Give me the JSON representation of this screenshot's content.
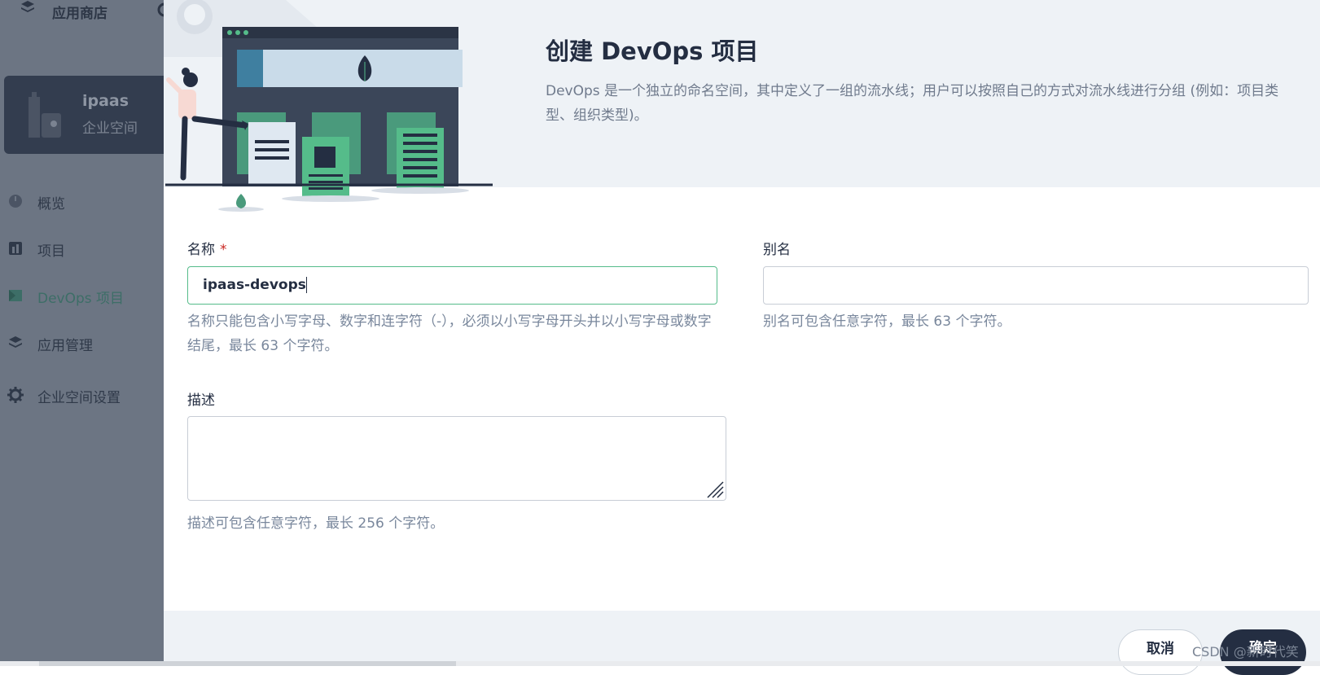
{
  "sidebar": {
    "app_store_label": "应用商店",
    "workspace": {
      "name": "ipaas",
      "type": "企业空间"
    },
    "items": [
      {
        "label": "概览",
        "icon": "dashboard-icon",
        "active": false
      },
      {
        "label": "项目",
        "icon": "project-icon",
        "active": false
      },
      {
        "label": "DevOps 项目",
        "icon": "devops-icon",
        "active": true
      },
      {
        "label": "应用管理",
        "icon": "app-layers-icon",
        "active": false
      },
      {
        "label": "企业空间设置",
        "icon": "gear-icon",
        "active": false
      }
    ]
  },
  "modal": {
    "title": "创建 DevOps 项目",
    "description": "DevOps 是一个独立的命名空间，其中定义了一组的流水线；用户可以按照自己的方式对流水线进行分组 (例如：项目类型、组织类型)。",
    "name_field": {
      "label": "名称",
      "required_mark": "*",
      "value": "ipaas-devops",
      "hint": "名称只能包含小写字母、数字和连字符（-），必须以小写字母开头并以小写字母或数字结尾，最长 63 个字符。"
    },
    "alias_field": {
      "label": "别名",
      "value": "",
      "hint": "别名可包含任意字符，最长 63 个字符。"
    },
    "description_field": {
      "label": "描述",
      "value": "",
      "hint": "描述可包含任意字符，最长 256 个字符。"
    },
    "footer": {
      "cancel_label": "取消",
      "ok_label": "确定"
    }
  },
  "watermark": "CSDN @新时代笑",
  "colors": {
    "accent_green": "#55bc8a",
    "primary_dark": "#242e42",
    "required_red": "#ca2621",
    "header_bg": "#eef2f6"
  }
}
